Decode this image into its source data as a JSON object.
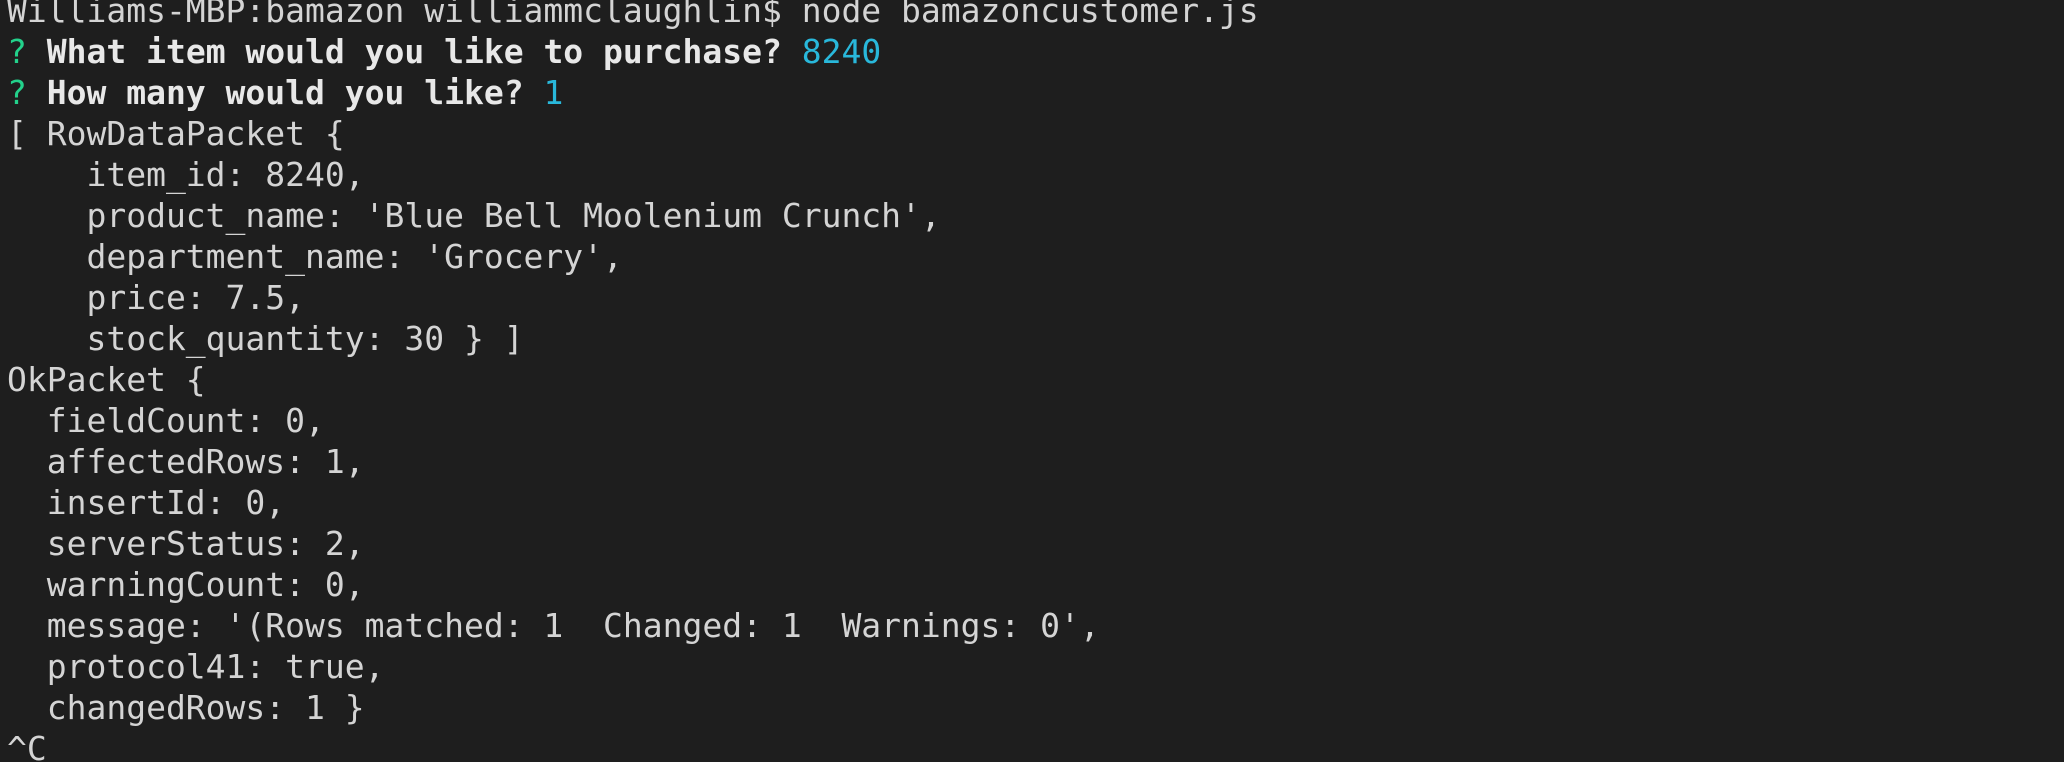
{
  "terminal": {
    "prompt_line": "Williams-MBP:bamazon williammclaughlin$ node bamazoncustomer.js",
    "question1": {
      "mark": "?",
      "text": "What item would you like to purchase?",
      "answer": "8240"
    },
    "question2": {
      "mark": "?",
      "text": "How many would you like?",
      "answer": "1"
    },
    "output_lines": [
      "[ RowDataPacket {",
      "    item_id: 8240,",
      "    product_name: 'Blue Bell Moolenium Crunch',",
      "    department_name: 'Grocery',",
      "    price: 7.5,",
      "    stock_quantity: 30 } ]",
      "OkPacket {",
      "  fieldCount: 0,",
      "  affectedRows: 1,",
      "  insertId: 0,",
      "  serverStatus: 2,",
      "  warningCount: 0,",
      "  message: '(Rows matched: 1  Changed: 1  Warnings: 0',",
      "  protocol41: true,",
      "  changedRows: 1 }",
      "^C"
    ]
  },
  "colors": {
    "background": "#1e1e1e",
    "text": "#d4d4d4",
    "question_mark": "#23d18b",
    "answer": "#29b8db"
  }
}
